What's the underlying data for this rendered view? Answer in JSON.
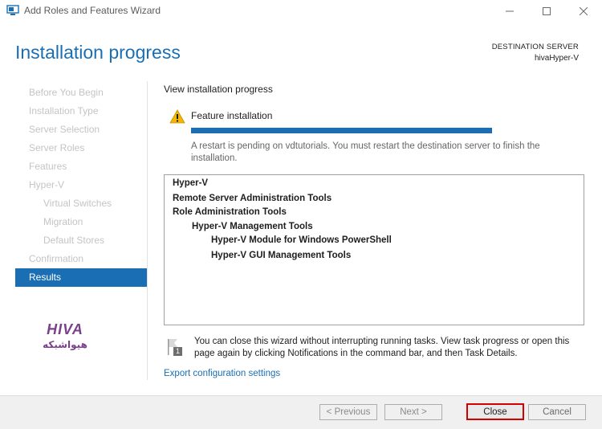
{
  "window": {
    "title": "Add Roles and Features Wizard",
    "minimize_glyph": "—",
    "maximize_glyph": "☐",
    "close_glyph": "✕"
  },
  "header": {
    "page_title": "Installation progress",
    "destination_label": "DESTINATION SERVER",
    "destination_server": "hivaHyper-V"
  },
  "sidebar": {
    "items": [
      {
        "label": "Before You Begin",
        "level": 0,
        "active": false
      },
      {
        "label": "Installation Type",
        "level": 0,
        "active": false
      },
      {
        "label": "Server Selection",
        "level": 0,
        "active": false
      },
      {
        "label": "Server Roles",
        "level": 0,
        "active": false
      },
      {
        "label": "Features",
        "level": 0,
        "active": false
      },
      {
        "label": "Hyper-V",
        "level": 0,
        "active": false
      },
      {
        "label": "Virtual Switches",
        "level": 1,
        "active": false
      },
      {
        "label": "Migration",
        "level": 1,
        "active": false
      },
      {
        "label": "Default Stores",
        "level": 1,
        "active": false
      },
      {
        "label": "Confirmation",
        "level": 0,
        "active": false
      },
      {
        "label": "Results",
        "level": 0,
        "active": true
      }
    ]
  },
  "logo": {
    "text_latin": "HIVA",
    "text_persian": "هیواشبکه",
    "color": "#7b3f8c"
  },
  "main": {
    "section_label": "View installation progress",
    "feature_title": "Feature installation",
    "progress_fraction": 1.0,
    "restart_message": "A restart is pending on vdtutorials. You must restart the destination server to finish the installation.",
    "results": [
      {
        "text": "Hyper-V",
        "indent": 0
      },
      {
        "text": "Remote Server Administration Tools",
        "indent": 0
      },
      {
        "text": "Role Administration Tools",
        "indent": 1
      },
      {
        "text": "Hyper-V Management Tools",
        "indent": 2
      },
      {
        "text": "Hyper-V Module for Windows PowerShell",
        "indent": 3
      },
      {
        "text": "Hyper-V GUI Management Tools",
        "indent": 3
      }
    ],
    "info_badge": "1",
    "info_message": "You can close this wizard without interrupting running tasks. View task progress or open this page again by clicking Notifications in the command bar, and then Task Details.",
    "export_link": "Export configuration settings"
  },
  "footer": {
    "previous_label": "< Previous",
    "next_label": "Next >",
    "close_label": "Close",
    "cancel_label": "Cancel"
  },
  "colors": {
    "accent": "#1a6fb4",
    "highlight_border": "#d40000",
    "warning": "#f2b705"
  }
}
